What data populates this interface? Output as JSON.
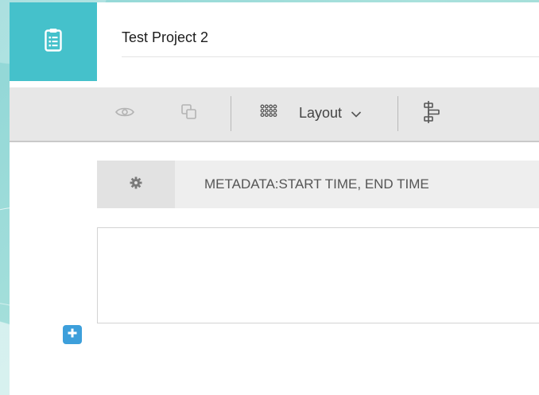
{
  "header": {
    "logo_icon": "clipboard-list-icon",
    "project_title": "Test Project 2"
  },
  "toolbar": {
    "preview_icon": "eye-icon",
    "duplicate_icon": "copy-icon",
    "layout_icon": "grid-dots-icon",
    "layout_label": "Layout",
    "layout_chevron": "chevron-down-icon",
    "align_icon": "align-blocks-icon"
  },
  "metadata_bar": {
    "settings_icon": "gear-icon",
    "label": "METADATA:START TIME, END TIME"
  },
  "actions": {
    "add_icon": "plus-icon"
  },
  "colors": {
    "brand_teal": "#45c1cb",
    "toolbar_bg": "#e7e7e7",
    "add_button_blue": "#3d9fdb"
  }
}
